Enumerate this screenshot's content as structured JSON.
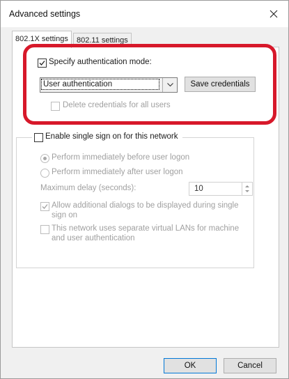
{
  "window": {
    "title": "Advanced settings"
  },
  "tabs": [
    {
      "label": "802.1X settings",
      "active": true
    },
    {
      "label": "802.11 settings",
      "active": false
    }
  ],
  "auth": {
    "specify_mode_label": "Specify authentication mode:",
    "specify_mode_checked": true,
    "mode_value": "User authentication",
    "save_credentials_label": "Save credentials",
    "delete_credentials_label": "Delete credentials for all users",
    "delete_credentials_checked": false
  },
  "sso": {
    "enable_label": "Enable single sign on for this network",
    "enable_checked": false,
    "before_logon_label": "Perform immediately before user logon",
    "before_logon_selected": true,
    "after_logon_label": "Perform immediately after user logon",
    "after_logon_selected": false,
    "max_delay_label": "Maximum delay (seconds):",
    "max_delay_value": "10",
    "allow_dialogs_line1": "Allow additional dialogs to be displayed during single",
    "allow_dialogs_line2": "sign on",
    "allow_dialogs_checked": true,
    "vlan_line1": "This network uses separate virtual LANs for machine",
    "vlan_line2": "and user authentication",
    "vlan_checked": false
  },
  "footer": {
    "ok_label": "OK",
    "cancel_label": "Cancel"
  },
  "colors": {
    "highlight": "#d7182a",
    "dialog_bg": "#f0f0f0"
  }
}
